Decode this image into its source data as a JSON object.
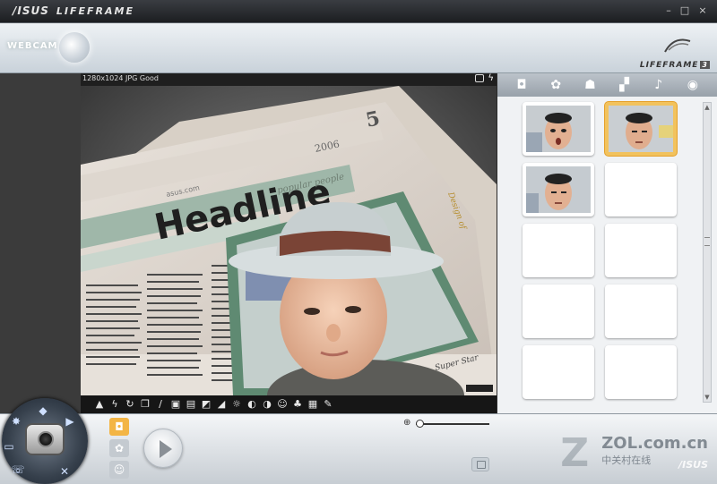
{
  "titlebar": {
    "brand": "/ISUS",
    "app_name": "LIFEFRAME",
    "minimize": "–",
    "maximize": "□",
    "close": "×"
  },
  "header": {
    "mode_label": "WEBCAM",
    "logo_text": "LIFEFRAME",
    "logo_version": "3"
  },
  "preview": {
    "info": "1280x1024 JPG Good",
    "newspaper": {
      "page_number": "5",
      "year": "2006",
      "headline": "Headline",
      "subline": "popular people",
      "site": "asus.com",
      "caption": "Super Star",
      "side_text": "Design of"
    }
  },
  "effects_bar": {
    "icons": [
      "scene-icon",
      "flash-icon",
      "timer-icon",
      "layers-icon",
      "ruler-icon",
      "frame-icon",
      "text-frame-icon",
      "panel-icon",
      "gradient-icon",
      "brightness-icon",
      "contrast-icon",
      "tint-icon",
      "face-icon",
      "color-balance-icon",
      "window-icon",
      "wrench-icon"
    ]
  },
  "right_panel": {
    "tabs": [
      "camera-tab",
      "effects-tab",
      "face-tab",
      "gallery-tab",
      "audio-tab",
      "preview-tab"
    ],
    "thumbnails": [
      {
        "has_photo": true,
        "selected": false,
        "expression": "surprised"
      },
      {
        "has_photo": true,
        "selected": true,
        "expression": "neutral"
      },
      {
        "has_photo": true,
        "selected": false,
        "expression": "neutral"
      },
      {
        "has_photo": false,
        "selected": false
      },
      {
        "has_photo": false,
        "selected": false
      },
      {
        "has_photo": false,
        "selected": false
      },
      {
        "has_photo": false,
        "selected": false
      },
      {
        "has_photo": false,
        "selected": false
      },
      {
        "has_photo": false,
        "selected": false
      },
      {
        "has_photo": false,
        "selected": false
      }
    ]
  },
  "bottom": {
    "zoom_level": 0.05,
    "watermark_site": "ZOL.com.cn",
    "watermark_cn": "中关村在线",
    "watermark_brand": "/ISUS"
  },
  "colors": {
    "accent": "#f3b545",
    "panel": "#f0f2f4",
    "dark": "#161616"
  }
}
